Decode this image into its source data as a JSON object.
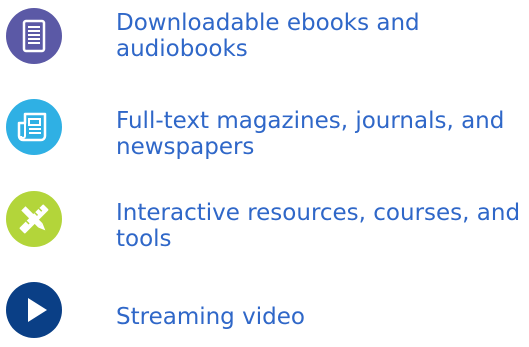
{
  "colors": {
    "label_text": "#2f67c8",
    "ebook_icon_bg": "#5b59a6",
    "magazine_icon_bg": "#2fb0e4",
    "resources_icon_bg": "#b3d53a",
    "video_icon_bg": "#0a3f86"
  },
  "items": [
    {
      "label": "Downloadable ebooks and audiobooks",
      "icon": "ebook-reader-icon"
    },
    {
      "label": "Full-text magazines, journals, and newspapers",
      "icon": "newspaper-icon"
    },
    {
      "label": "Interactive resources, courses, and tools",
      "icon": "tools-icon"
    },
    {
      "label": "Streaming video",
      "icon": "play-icon"
    }
  ]
}
